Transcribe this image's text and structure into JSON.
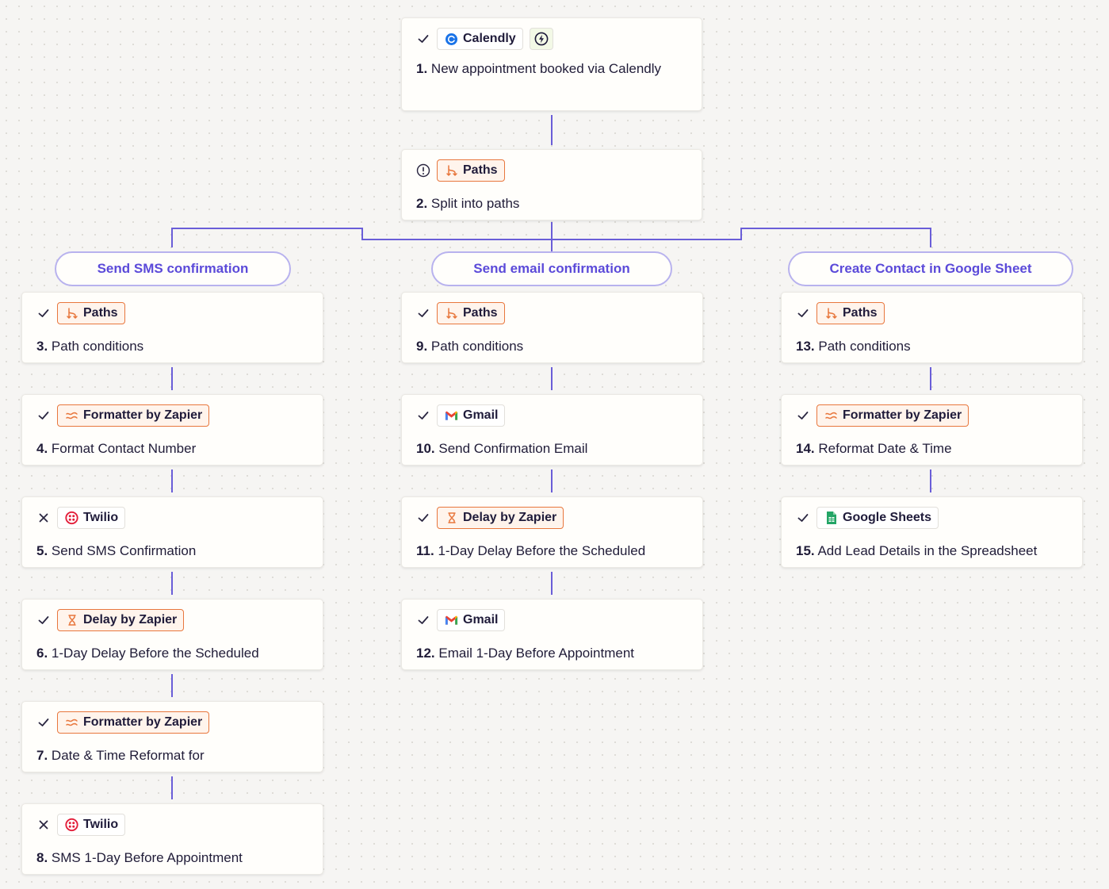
{
  "colors": {
    "wire": "#6a5ed8",
    "branch_border": "#b8b2ee",
    "branch_text": "#5b4ad9",
    "accent_orange": "#e8773d"
  },
  "trigger": {
    "status": "check-icon",
    "app": "Calendly",
    "num": "1.",
    "title": "New appointment booked via Calendly"
  },
  "split": {
    "status": "alert-icon",
    "app": "Paths",
    "num": "2.",
    "title": "Split into paths"
  },
  "branches": [
    {
      "label": "Send SMS confirmation",
      "steps": [
        {
          "num": "3.",
          "title": "Path conditions",
          "app": "Paths",
          "status": "check"
        },
        {
          "num": "4.",
          "title": "Format Contact Number",
          "app": "Formatter by Zapier",
          "status": "check"
        },
        {
          "num": "5.",
          "title": "Send SMS Confirmation",
          "app": "Twilio",
          "status": "x"
        },
        {
          "num": "6.",
          "title": "1-Day Delay Before the Scheduled",
          "app": "Delay by Zapier",
          "status": "check"
        },
        {
          "num": "7.",
          "title": "Date & Time Reformat for",
          "app": "Formatter by Zapier",
          "status": "check"
        },
        {
          "num": "8.",
          "title": "SMS 1-Day Before Appointment",
          "app": "Twilio",
          "status": "x"
        }
      ]
    },
    {
      "label": "Send email confirmation",
      "steps": [
        {
          "num": "9.",
          "title": "Path conditions",
          "app": "Paths",
          "status": "check"
        },
        {
          "num": "10.",
          "title": "Send Confirmation Email",
          "app": "Gmail",
          "status": "check"
        },
        {
          "num": "11.",
          "title": "1-Day Delay Before the Scheduled",
          "app": "Delay by Zapier",
          "status": "check"
        },
        {
          "num": "12.",
          "title": "Email 1-Day Before Appointment",
          "app": "Gmail",
          "status": "check"
        }
      ]
    },
    {
      "label": "Create Contact in Google Sheet",
      "steps": [
        {
          "num": "13.",
          "title": "Path conditions",
          "app": "Paths",
          "status": "check"
        },
        {
          "num": "14.",
          "title": "Reformat Date & Time",
          "app": "Formatter by Zapier",
          "status": "check"
        },
        {
          "num": "15.",
          "title": "Add Lead Details in the Spreadsheet",
          "app": "Google Sheets",
          "status": "check"
        }
      ]
    }
  ]
}
